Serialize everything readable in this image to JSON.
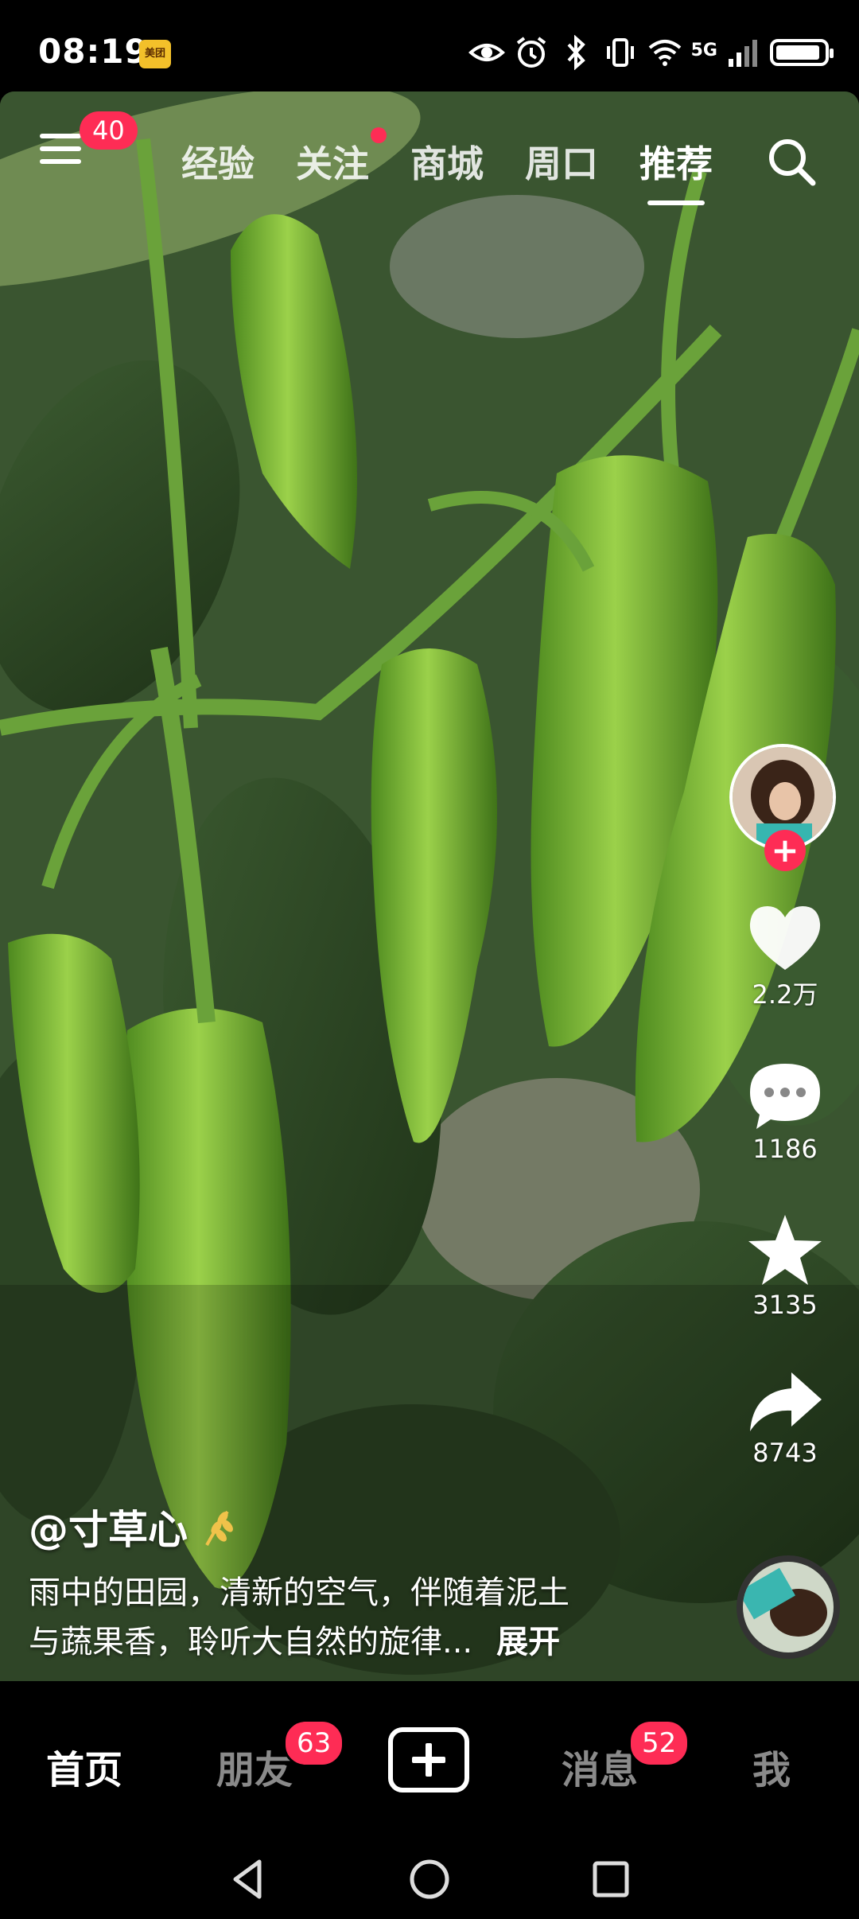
{
  "status_bar": {
    "time": "08:19",
    "app_badge": "美团",
    "network": "5G"
  },
  "top_nav": {
    "menu_badge": "40",
    "tabs": [
      {
        "label": "经验"
      },
      {
        "label": "关注"
      },
      {
        "label": "商城"
      },
      {
        "label": "周口"
      },
      {
        "label": "推荐",
        "active": true
      }
    ]
  },
  "post": {
    "author": "@寸草心",
    "description_line1": "雨中的田园，清新的空气，伴随着泥土",
    "description_line2": "与蔬果香，聆听大自然的旋律...",
    "expand_label": "展开"
  },
  "right_rail": {
    "likes": "2.2万",
    "comments": "1186",
    "favorites": "3135",
    "shares": "8743"
  },
  "bottom_nav": {
    "home": "首页",
    "friends": "朋友",
    "friends_badge": "63",
    "messages": "消息",
    "messages_badge": "52",
    "me": "我"
  },
  "colors": {
    "accent": "#fe2c55",
    "pepper": "#7fbf3a"
  }
}
